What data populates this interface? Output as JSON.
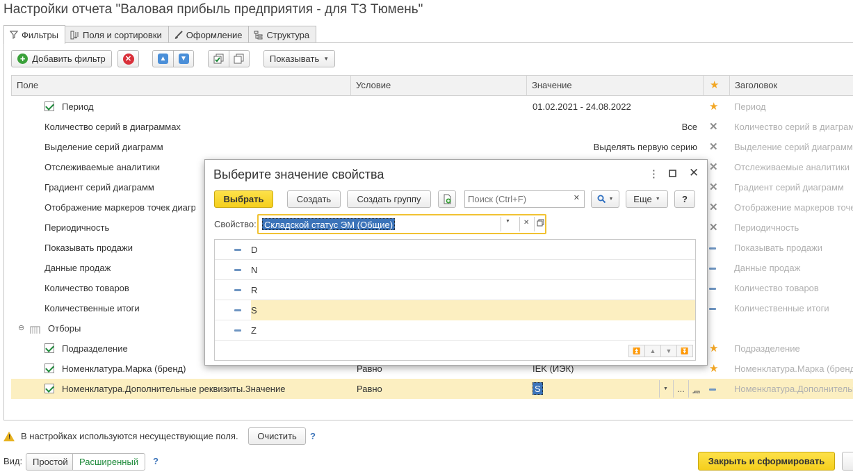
{
  "window": {
    "title": "Настройки отчета \"Валовая прибыль предприятия - для ТЗ Тюмень\""
  },
  "tabs": [
    {
      "label": "Фильтры",
      "icon": "funnel-icon",
      "active": true
    },
    {
      "label": "Поля и сортировки",
      "icon": "columns-sort-icon",
      "active": false
    },
    {
      "label": "Оформление",
      "icon": "brush-icon",
      "active": false
    },
    {
      "label": "Структура",
      "icon": "tree-structure-icon",
      "active": false
    }
  ],
  "toolbar": {
    "add_filter": "Добавить фильтр",
    "show": "Показывать"
  },
  "grid": {
    "headers": {
      "field": "Поле",
      "condition": "Условие",
      "value": "Значение",
      "title": "Заголовок"
    },
    "rows": [
      {
        "field": "Период",
        "condition": "",
        "value": "01.02.2021 - 24.08.2022",
        "title": "Период"
      },
      {
        "field": "Количество серий в диаграммах",
        "condition": "",
        "value": "Все",
        "title": "Количество серий в диаграммах"
      },
      {
        "field": "Выделение серий диаграмм",
        "condition": "",
        "value": "Выделять первую серию",
        "title": "Выделение серий диаграмм"
      },
      {
        "field": "Отслеживаемые аналитики",
        "condition": "",
        "value": "",
        "title": "Отслеживаемые аналитики"
      },
      {
        "field": "Градиент серий диаграмм",
        "condition": "",
        "value": "",
        "title": "Градиент серий диаграмм"
      },
      {
        "field": "Отображение маркеров точек диаграмм",
        "condition": "",
        "value": "",
        "title": "Отображение маркеров точек диаграмм"
      },
      {
        "field": "Периодичность",
        "condition": "",
        "value": "",
        "title": "Периодичность"
      },
      {
        "field": "Показывать продажи",
        "condition": "",
        "value": "",
        "title": "Показывать продажи"
      },
      {
        "field": "Данные продаж",
        "condition": "",
        "value": "",
        "title": "Данные продаж"
      },
      {
        "field": "Количество товаров",
        "condition": "",
        "value": "",
        "title": "Количество товаров"
      },
      {
        "field": "Количественные итоги",
        "condition": "",
        "value": "",
        "title": "Количественные итоги"
      },
      {
        "field": "Отборы",
        "condition": "",
        "value": "",
        "title": ""
      },
      {
        "field": "Подразделение",
        "condition": "",
        "value": "",
        "title": "Подразделение"
      },
      {
        "field": "Номенклатура.Марка (бренд)",
        "condition": "Равно",
        "value": "IEK (ИЭК)",
        "title": "Номенклатура.Марка (бренд)"
      },
      {
        "field": "Номенклатура.Дополнительные реквизиты.Значение",
        "condition": "Равно",
        "value": "S",
        "title": "Номенклатура.Дополнительные реквизиты.Значение"
      }
    ]
  },
  "dialog": {
    "title": "Выберите значение свойства",
    "select": "Выбрать",
    "create": "Создать",
    "create_group": "Создать группу",
    "search_placeholder": "Поиск (Ctrl+F)",
    "more": "Еще",
    "help": "?",
    "property_label": "Свойство:",
    "property_value": "Складской статус ЭМ (Общие)",
    "items": [
      "D",
      "N",
      "R",
      "S",
      "Z"
    ],
    "selected_item": "S"
  },
  "footer": {
    "warning": "В настройках используются несуществующие поля.",
    "clear": "Очистить",
    "view_label": "Вид:",
    "simple": "Простой",
    "extended": "Расширенный",
    "help": "?",
    "close_and_build": "Закрыть и сформировать"
  },
  "colors": {
    "accent_yellow": "#f5cf1c",
    "selection": "#fcefc1",
    "check_green": "#1e8a3a",
    "star": "#f2a623"
  }
}
